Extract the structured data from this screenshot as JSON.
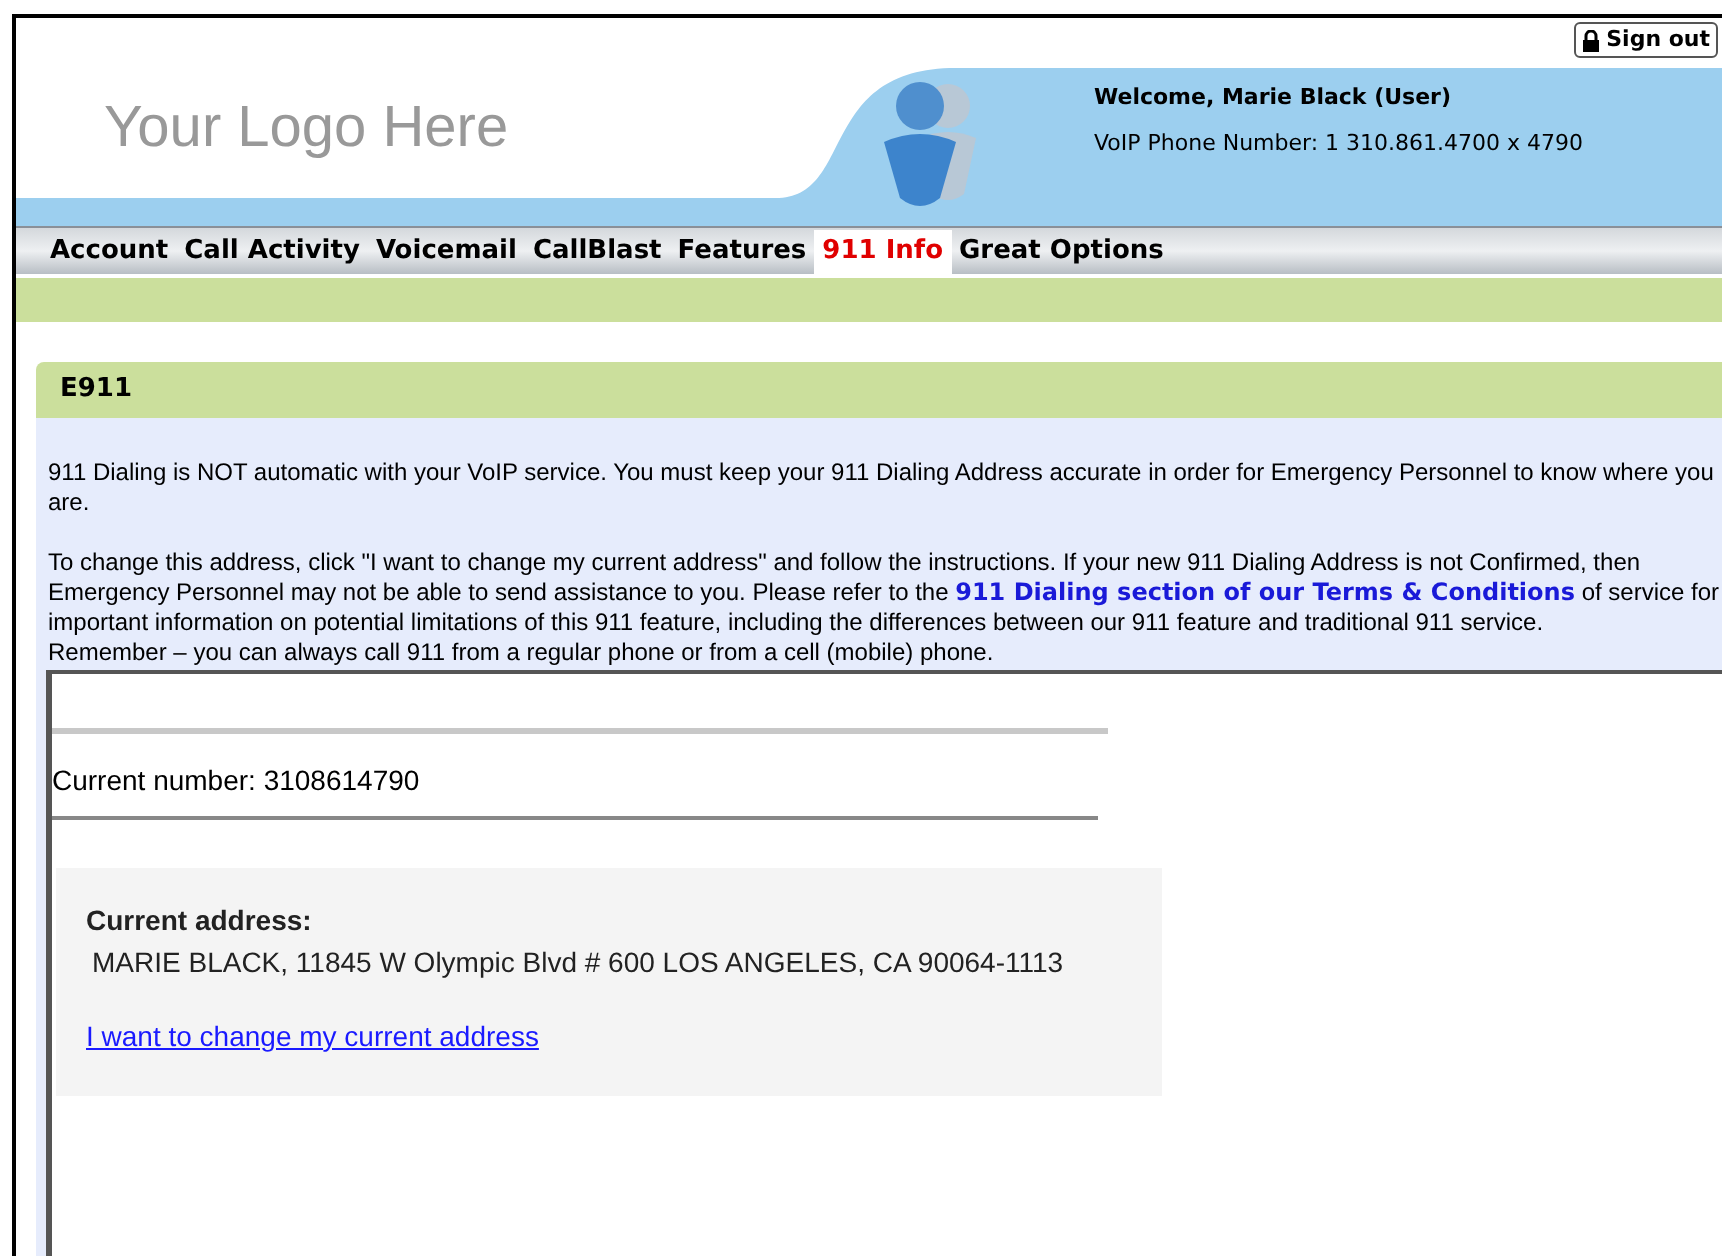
{
  "header": {
    "sign_out": "Sign out",
    "logo": "Your Logo Here",
    "welcome": "Welcome, Marie Black (User)",
    "phone": "VoIP Phone Number: 1 310.861.4700 x 4790"
  },
  "nav": [
    {
      "label": "Account",
      "selected": false
    },
    {
      "label": "Call Activity",
      "selected": false
    },
    {
      "label": "Voicemail",
      "selected": false
    },
    {
      "label": "CallBlast",
      "selected": false
    },
    {
      "label": "Features",
      "selected": false
    },
    {
      "label": "911 Info",
      "selected": true
    },
    {
      "label": "Great Options",
      "selected": false
    }
  ],
  "panel": {
    "title": "E911",
    "intro": "911 Dialing is NOT automatic with your VoIP service. You must keep your 911 Dialing Address accurate in order for Emergency Personnel to know where you are.",
    "change_before": "To change this address, click \"I want to change my current address\" and follow the instructions. If your new 911 Dialing Address is not Confirmed, then Emergency Personnel may not be able to send assistance to you. Please refer to the",
    "change_link": "911 Dialing section of our Terms & Conditions",
    "change_after": "of service for important information on potential limitations of this 911 feature, including the differences between our 911 feature and traditional 911 service.",
    "reminder": "Remember – you can always call 911 from a regular phone or from a cell (mobile) phone."
  },
  "details": {
    "current_number": "Current number: 3108614790",
    "address_label": "Current address:",
    "address": "MARIE BLACK, 11845 W Olympic Blvd # 600 LOS ANGELES, CA 90064-1113",
    "change_link": "I want to change my current address"
  }
}
